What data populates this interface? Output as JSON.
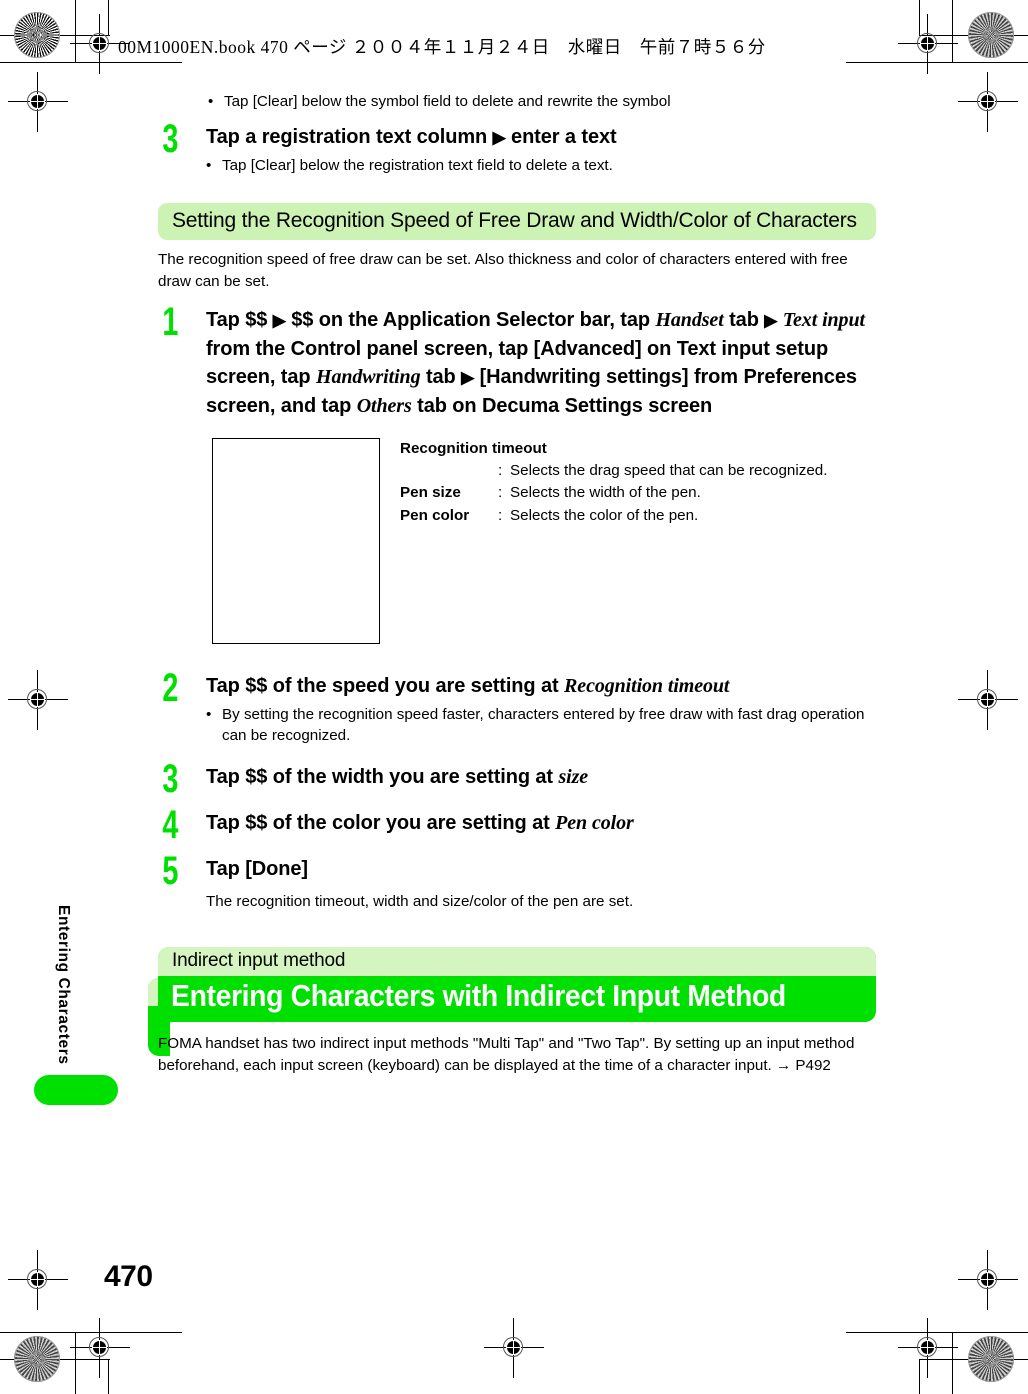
{
  "slugline": "00M1000EN.book  470 ページ  ２００４年１１月２４日　水曜日　午前７時５６分",
  "sidebar": {
    "chapter_label": "Entering Characters",
    "page_number": "470"
  },
  "top_bullet": {
    "marker": "•",
    "text": "Tap [Clear] below the symbol field to delete and rewrite the symbol"
  },
  "step_three_top": {
    "number": "3",
    "title_before": "Tap a registration text column",
    "arrow": "▶",
    "title_after": "enter a text",
    "bullet_marker": "•",
    "bullet_text": "Tap [Clear] below the registration text field to delete a text."
  },
  "section": {
    "heading": "Setting the Recognition Speed of Free Draw and Width/Color of Characters",
    "intro": "The recognition speed of free draw can be set. Also thickness and color of characters entered with free draw can be set."
  },
  "step_one": {
    "number": "1",
    "seg1": "Tap $$",
    "arrow1": "▶",
    "seg2": "$$ on the Application Selector bar, tap",
    "italic1": "Handset",
    "seg3": "tab",
    "arrow2": "▶",
    "italic2": "Text input",
    "seg4": "from the Control panel screen, tap [Advanced] on Text input setup screen, tap",
    "italic3": "Handwriting",
    "seg5": "tab",
    "arrow3": "▶",
    "seg6": "[Handwriting settings] from Preferences screen, and tap",
    "italic4": "Others",
    "seg7": "tab on Decuma Settings screen"
  },
  "figure": {
    "alt_name": "decuma-settings-screen-figure"
  },
  "definitions": {
    "head": "Recognition timeout",
    "rows": [
      {
        "term": "",
        "colon": ":",
        "desc": "Selects the drag speed that can be recognized."
      },
      {
        "term": "Pen size",
        "colon": ":",
        "desc": "Selects the width of the pen."
      },
      {
        "term": "Pen color",
        "colon": ":",
        "desc": "Selects the color of the pen."
      }
    ]
  },
  "step_two": {
    "number": "2",
    "title_before": "Tap $$ of the speed you are setting at",
    "italic": "Recognition timeout",
    "bullet_marker": "•",
    "bullet_text": "By setting the recognition speed faster, characters entered by free draw with fast drag operation can be recognized."
  },
  "step_three": {
    "number": "3",
    "title_before": "Tap $$ of the width you are setting at",
    "italic": "size"
  },
  "step_four": {
    "number": "4",
    "title_before": "Tap $$ of the color you are setting at",
    "italic": "Pen color"
  },
  "step_five": {
    "number": "5",
    "title": "Tap [Done]",
    "sub": "The recognition timeout, width and size/color of the pen are set."
  },
  "chapter_banner": {
    "kicker": "Indirect input method",
    "title": "Entering Characters with Indirect Input Method",
    "intro": "FOMA handset has two indirect input methods \"Multi Tap\" and \"Two Tap\". By setting up an input method beforehand, each input screen (keyboard) can be displayed at the time of a character input. → P492"
  },
  "colors": {
    "accent_green": "#00e000",
    "pale_green": "#cdf3b4",
    "banner_kicker_green": "#d5f5c0"
  }
}
